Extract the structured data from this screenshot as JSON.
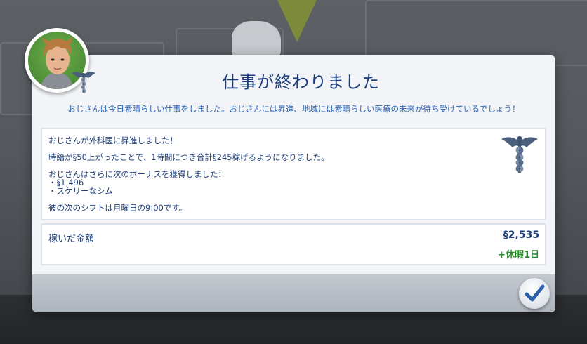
{
  "dialog": {
    "title": "仕事が終わりました",
    "subtitle": "おじさんは今日素晴らしい仕事をしました。おじさんには昇進、地域には素晴らしい医療の未来が待ち受けているでしょう！",
    "info": {
      "promotion": "おじさんが外科医に昇進しました！",
      "raise": "時給が§50上がったことで、1時間につき合計§245稼げるようになりました。",
      "bonus_intro": "おじさんはさらに次のボーナスを獲得しました：",
      "bonus_items": [
        "・§1,496",
        "・スケリーなシム"
      ],
      "next_shift": "彼の次のシフトは月曜日の9:00です。"
    },
    "earnings": {
      "label": "稼いだ金額",
      "amount": "§2,535",
      "bonus": "+休暇1日"
    }
  },
  "icons": {
    "career": "caduceus-icon",
    "ok": "checkmark-icon"
  },
  "colors": {
    "title": "#1a3e7a",
    "subtitle": "#2a66b8",
    "body_text": "#1e3f7a",
    "bonus_green": "#2a8a2a",
    "panel_bg": "#ffffff",
    "dialog_bg": "#f2f4f7"
  }
}
